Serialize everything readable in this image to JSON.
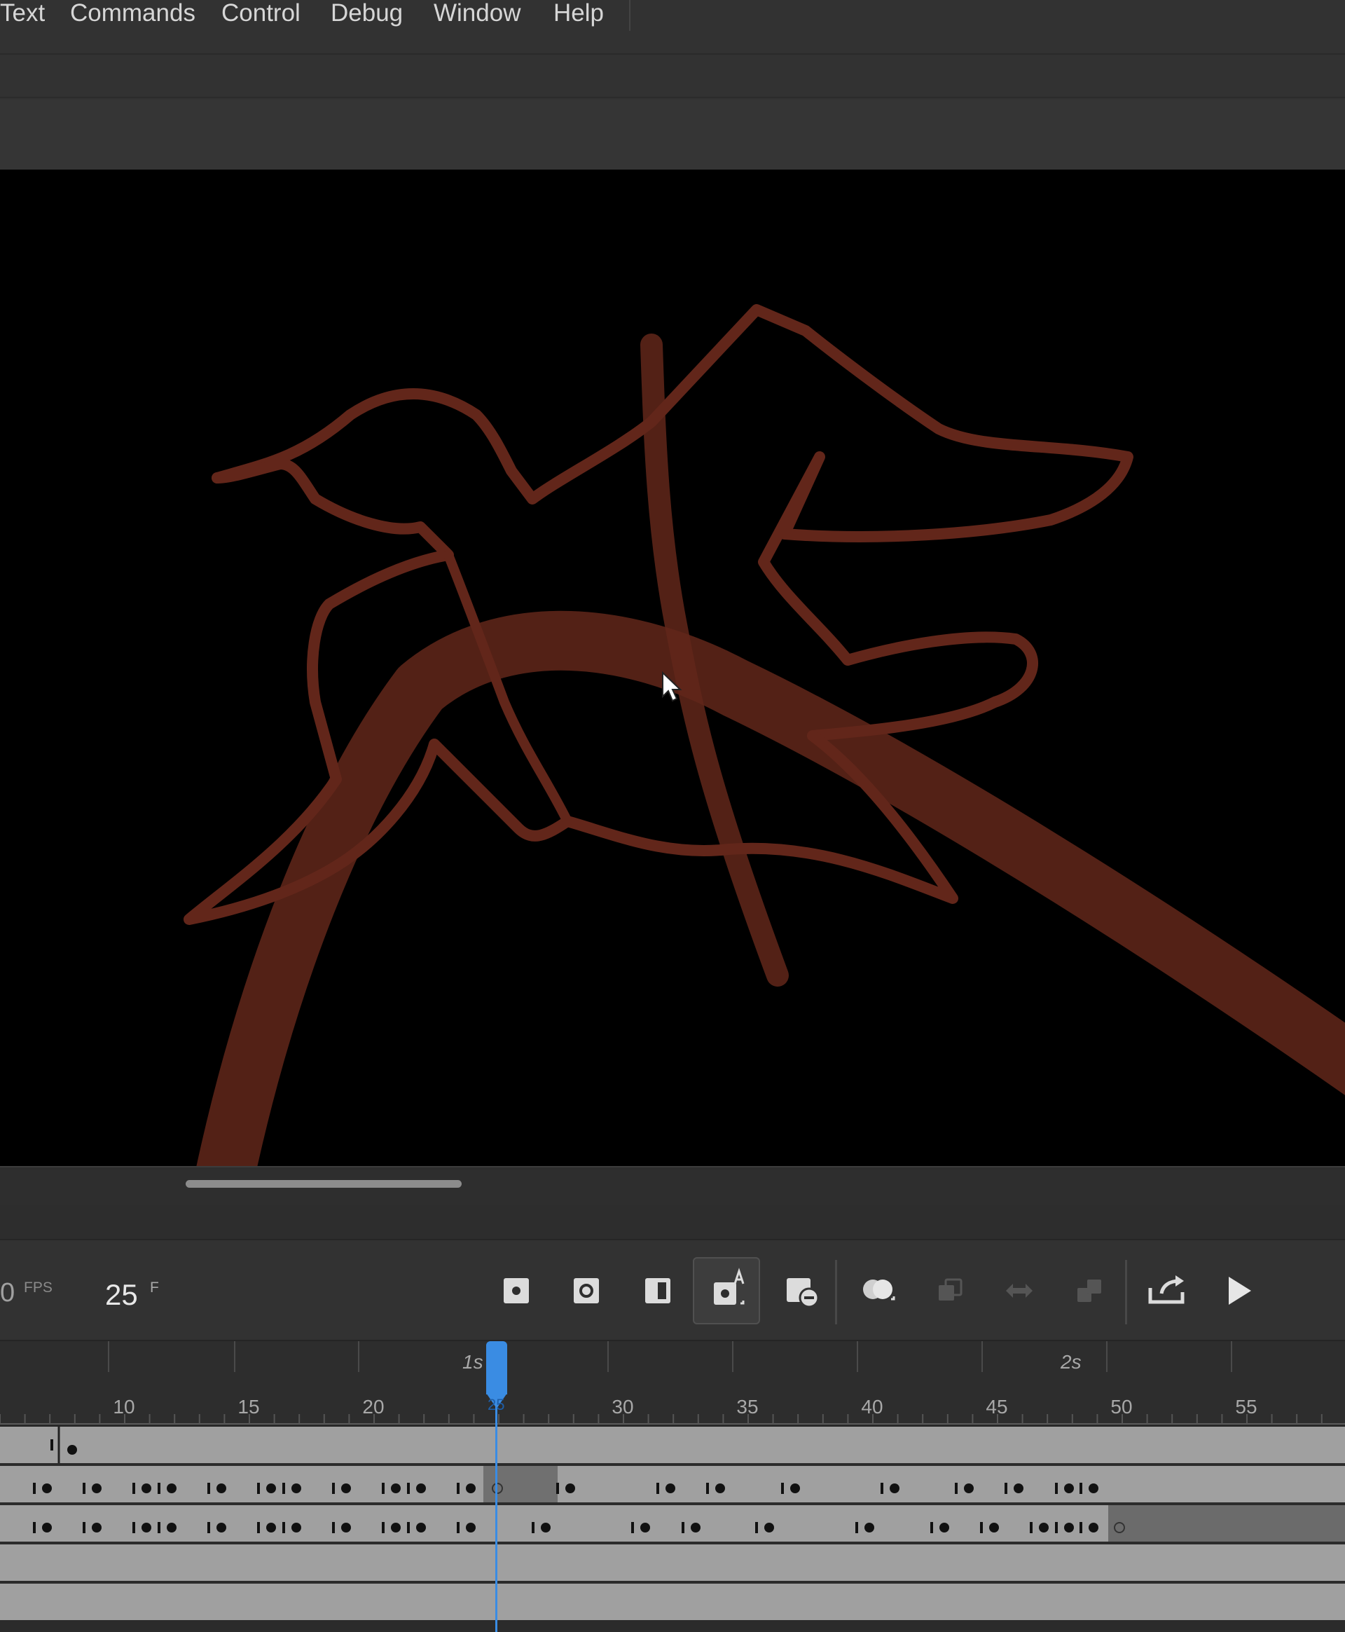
{
  "menu": {
    "items": [
      "Text",
      "Commands",
      "Control",
      "Debug",
      "Window",
      "Help"
    ]
  },
  "stage": {
    "background": "#000000",
    "stroke_color": "#6b2a1d"
  },
  "timeline": {
    "fps_value": "0",
    "fps_label": "FPS",
    "frame_value": "25",
    "frame_unit": "F",
    "current_frame": "25",
    "seconds_labels": [
      "1s",
      "2s"
    ],
    "frame_numbers": [
      "10",
      "15",
      "20",
      "30",
      "35",
      "40",
      "45",
      "50",
      "55"
    ],
    "buttons": [
      "insert-keyframe-icon",
      "insert-blank-keyframe-icon",
      "insert-frame-icon",
      "auto-keyframe-icon",
      "remove-frame-icon",
      "onion-skin-icon",
      "edit-multiple-frames-icon",
      "loop-icon",
      "sync-icon",
      "export-icon",
      "play-icon"
    ],
    "accent": "#3a8ce3"
  }
}
